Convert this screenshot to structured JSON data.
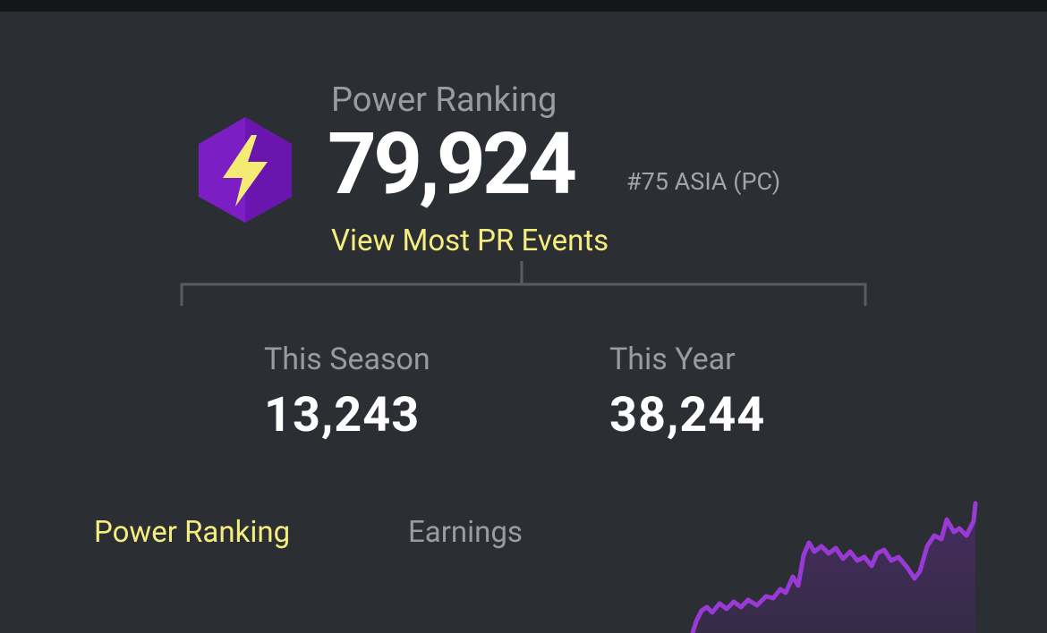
{
  "power_ranking": {
    "heading": "Power Ranking",
    "value": "79,924",
    "rank": "#75 ASIA (PC)",
    "link_label": "View Most PR Events",
    "icon": "lightning-bolt-hexagon-icon"
  },
  "stats": [
    {
      "label": "This Season",
      "value": "13,243"
    },
    {
      "label": "This Year",
      "value": "38,244"
    }
  ],
  "tabs": [
    {
      "label": "Power Ranking",
      "active": true
    },
    {
      "label": "Earnings",
      "active": false
    }
  ],
  "colors": {
    "background": "#2b2e33",
    "accent_yellow": "#f5ee7f",
    "hexagon_purple": "#7b1fc4",
    "chart_line": "#9a3ad6"
  }
}
